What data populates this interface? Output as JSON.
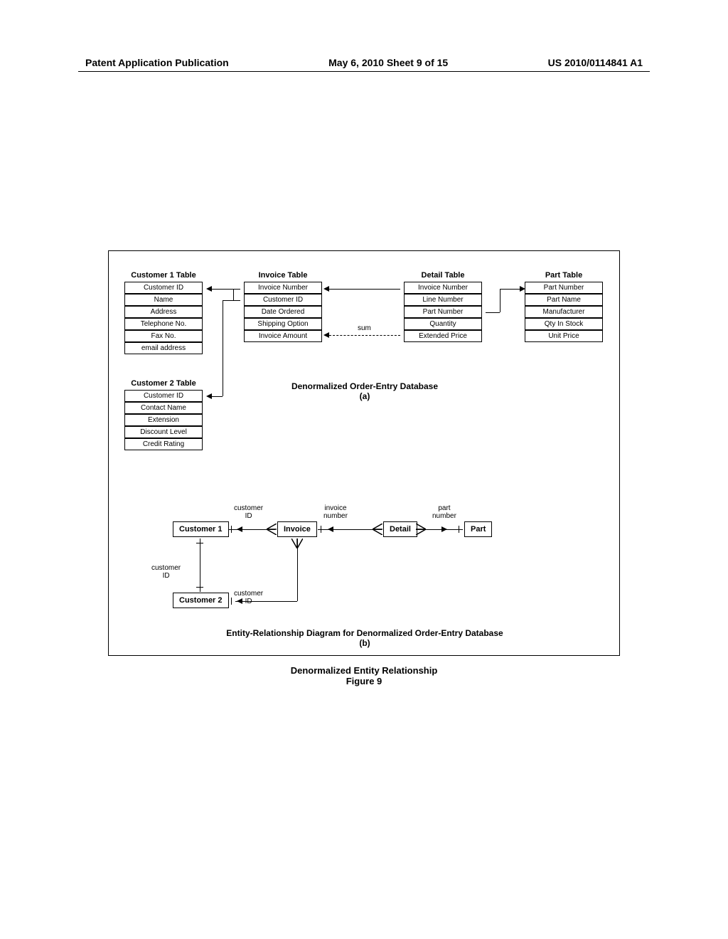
{
  "header": {
    "left": "Patent Application Publication",
    "center": "May 6, 2010  Sheet 9 of 15",
    "right": "US 2010/0114841 A1"
  },
  "tables": {
    "customer1": {
      "title": "Customer 1 Table",
      "rows": [
        "Customer ID",
        "Name",
        "Address",
        "Telephone No.",
        "Fax No.",
        "email address"
      ]
    },
    "customer2": {
      "title": "Customer 2 Table",
      "rows": [
        "Customer ID",
        "Contact Name",
        "Extension",
        "Discount Level",
        "Credit Rating"
      ]
    },
    "invoice": {
      "title": "Invoice Table",
      "rows": [
        "Invoice Number",
        "Customer ID",
        "Date Ordered",
        "Shipping Option",
        "Invoice Amount"
      ]
    },
    "detail": {
      "title": "Detail Table",
      "rows": [
        "Invoice Number",
        "Line Number",
        "Part Number",
        "Quantity",
        "Extended Price"
      ]
    },
    "part": {
      "title": "Part Table",
      "rows": [
        "Part Number",
        "Part Name",
        "Manufacturer",
        "Qty In Stock",
        "Unit Price"
      ]
    }
  },
  "labels": {
    "sum": "sum",
    "caption_a_line1": "Denormalized Order-Entry Database",
    "caption_a_line2": "(a)",
    "customer_id": "customer\nID",
    "invoice_number": "invoice\nnumber",
    "part_number": "part\nnumber",
    "caption_b_line1": "Entity-Relationship Diagram for Denormalized Order-Entry Database",
    "caption_b_line2": "(b)",
    "figure_title": "Denormalized Entity Relationship",
    "figure_num": "Figure 9"
  },
  "er": {
    "customer1": "Customer 1",
    "customer2": "Customer 2",
    "invoice": "Invoice",
    "detail": "Detail",
    "part": "Part"
  }
}
